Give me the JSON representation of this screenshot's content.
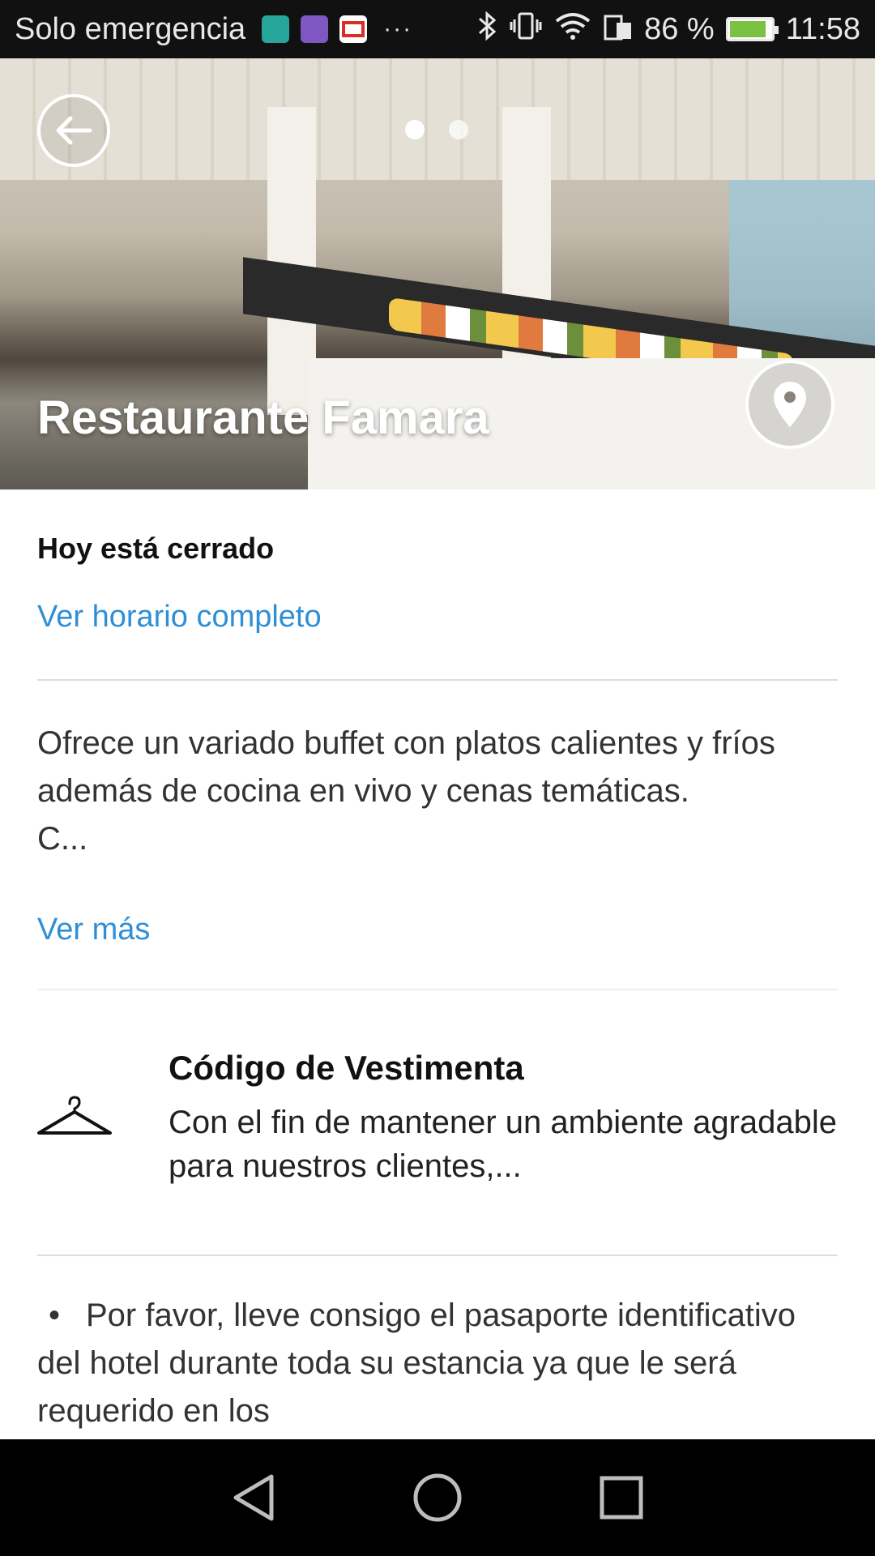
{
  "status_bar": {
    "carrier": "Solo emergencia",
    "notification_icons": [
      "android-icon",
      "gallery-icon",
      "gmail-icon"
    ],
    "more": "···",
    "battery_percent": "86 %",
    "time": "11:58"
  },
  "hero": {
    "title": "Restaurante Famara",
    "carousel": {
      "total": 2,
      "active": 1
    }
  },
  "hours": {
    "status": "Hoy está cerrado",
    "link": "Ver horario completo"
  },
  "description": {
    "text": "Ofrece un variado buffet con platos calientes y fríos además de cocina en vivo y cenas temáticas.\nC...",
    "more_link": "Ver más"
  },
  "dress_code": {
    "title": "Código de Vestimenta",
    "text": "Con el fin de mantener un ambiente agradable para nuestros clientes,..."
  },
  "notice": {
    "bullet": "•",
    "text": "Por favor, lleve consigo el pasaporte identificativo del hotel durante toda su estancia ya que le será requerido en los"
  },
  "colors": {
    "link": "#2f8fd6",
    "status_bar": "#111111",
    "nav_bar": "#000000"
  }
}
